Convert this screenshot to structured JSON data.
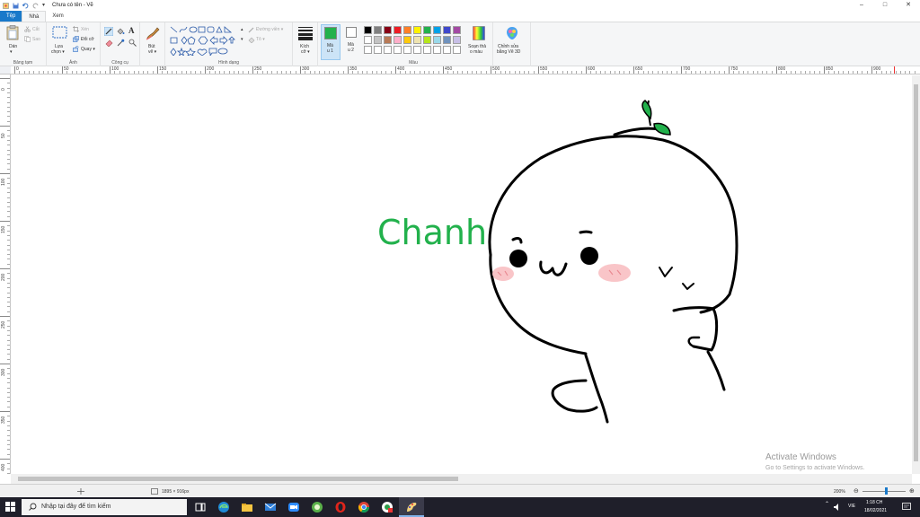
{
  "window": {
    "title": "Chưa có tên - Vẽ",
    "controls": [
      "–",
      "□",
      "✕"
    ]
  },
  "tabs": [
    "Tệp",
    "Nhà",
    "Xem"
  ],
  "ribbon": {
    "clipboard": {
      "paste": "Dán",
      "paste_sub": "▾",
      "cut": "Cắt",
      "copy": "Sao",
      "label": "Bảng tạm"
    },
    "image": {
      "select": "Lựa",
      "select_sub": "chọn ▾",
      "crop": "Xén",
      "resize": "Đổi cỡ",
      "rotate": "Quay ▾",
      "label": "Ảnh"
    },
    "tools": {
      "label": "Công cụ"
    },
    "brushes": {
      "label1": "Bút",
      "label2": "vẽ ▾"
    },
    "shapes": {
      "outline": "Đường viền ▾",
      "fill": "Tô ▾",
      "label": "Hình dạng"
    },
    "size": {
      "label1": "Kích",
      "label2": "cỡ ▾"
    },
    "color1": {
      "label1": "Mà",
      "label2": "u 1",
      "value": "#22b14c"
    },
    "color2": {
      "label1": "Mà",
      "label2": "u 2",
      "value": "#ffffff"
    },
    "colors": {
      "row1": [
        "#000000",
        "#7f7f7f",
        "#880015",
        "#ed1c24",
        "#ff7f27",
        "#fff200",
        "#22b14c",
        "#00a2e8",
        "#3f48cc",
        "#a349a4"
      ],
      "row2": [
        "#ffffff",
        "#c3c3c3",
        "#b97a57",
        "#ffaec9",
        "#ffc90e",
        "#efe4b0",
        "#b5e61d",
        "#99d9ea",
        "#7092be",
        "#c8bfe7"
      ],
      "row3": [
        "#ffffff",
        "#ffffff",
        "#ffffff",
        "#ffffff",
        "#ffffff",
        "#ffffff",
        "#ffffff",
        "#ffffff",
        "#ffffff",
        "#ffffff"
      ],
      "label": "Màu"
    },
    "edit_colors": {
      "label1": "Soạn thả",
      "label2": "o màu"
    },
    "paint3d": {
      "label1": "Chỉnh sửa",
      "label2": "bằng Vẽ 3D"
    }
  },
  "ruler": {
    "h_labels": [
      "0",
      "50",
      "100",
      "150",
      "200",
      "250",
      "300",
      "350",
      "400",
      "450",
      "500",
      "550",
      "600",
      "650",
      "700",
      "750",
      "800",
      "850",
      "900"
    ],
    "v_labels": [
      "0",
      "50",
      "100",
      "150",
      "200",
      "250",
      "300",
      "350",
      "400"
    ]
  },
  "canvas": {
    "text": "Chanh",
    "text_color": "#22b14c"
  },
  "watermark": {
    "line1": "Activate Windows",
    "line2": "Go to Settings to activate Windows."
  },
  "status": {
    "size": "1895 × 916px",
    "zoom": "200%"
  },
  "taskbar": {
    "search_placeholder": "Nhập tại đây để tìm kiếm",
    "lang": "VIE",
    "time": "1:18 CH",
    "date": "18/02/2021"
  }
}
